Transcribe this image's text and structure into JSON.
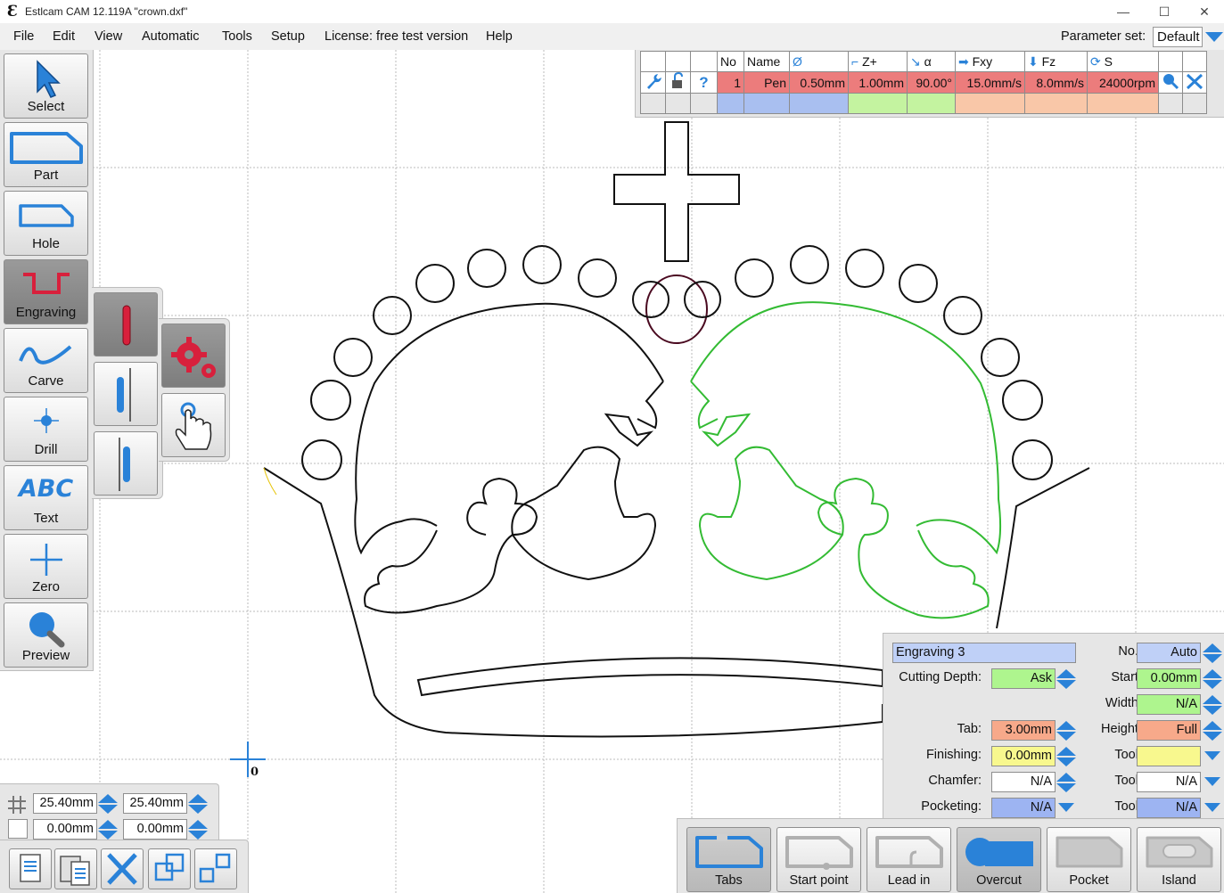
{
  "window": {
    "title": "Estlcam CAM 12.119A \"crown.dxf\"",
    "minimize": "—",
    "maximize": "☐",
    "close": "✕"
  },
  "menu": {
    "items": [
      "File",
      "Edit",
      "View",
      "Automatic",
      "Tools",
      "Setup",
      "License: free test version",
      "Help"
    ],
    "param_label": "Parameter set:",
    "param_value": "Default"
  },
  "left_toolbar": {
    "buttons": [
      {
        "label": "Select",
        "icon": "cursor-arrow-icon"
      },
      {
        "label": "Part",
        "icon": "part-outline-icon"
      },
      {
        "label": "Hole",
        "icon": "hole-outline-icon"
      },
      {
        "label": "Engraving",
        "icon": "engraving-icon",
        "active": true
      },
      {
        "label": "Carve",
        "icon": "carve-wave-icon"
      },
      {
        "label": "Drill",
        "icon": "drill-crosshair-icon"
      },
      {
        "label": "Text",
        "icon": "text-abc-icon",
        "text": "ABC"
      },
      {
        "label": "Zero",
        "icon": "zero-plus-icon"
      },
      {
        "label": "Preview",
        "icon": "magnifier-icon"
      }
    ]
  },
  "tool_table": {
    "headers": [
      "No",
      "Name",
      "Ø",
      "Z+",
      "α",
      "Fxy",
      "Fz",
      "S"
    ],
    "row": {
      "no": "1",
      "name": "Pen",
      "diameter": "0.50mm",
      "z_plus": "1.00mm",
      "angle": "90.00°",
      "fxy": "15.0mm/s",
      "fz": "8.0mm/s",
      "speed": "24000rpm"
    },
    "help_icon": "?"
  },
  "properties": {
    "name": "Engraving 3",
    "no_label": "No.:",
    "no_value": "Auto",
    "cutting_depth_label": "Cutting Depth:",
    "cutting_depth_value": "Ask",
    "start_label": "Start:",
    "start_value": "0.00mm",
    "width_label": "Width:",
    "width_value": "N/A",
    "tab_label": "Tab:",
    "tab_value": "3.00mm",
    "height_label": "Height:",
    "height_value": "Full",
    "finishing_label": "Finishing:",
    "finishing_value": "0.00mm",
    "tool1_label": "Tool:",
    "tool1_value": "",
    "chamfer_label": "Chamfer:",
    "chamfer_value": "N/A",
    "tool2_label": "Tool:",
    "tool2_value": "N/A",
    "pocketing_label": "Pocketing:",
    "pocketing_value": "N/A",
    "tool3_label": "Tool:",
    "tool3_value": "N/A"
  },
  "bottom_toolbar": {
    "buttons": [
      "Tabs",
      "Start point",
      "Lead in",
      "Overcut",
      "Pocket",
      "Island"
    ]
  },
  "grid_panel": {
    "grid_x": "25.40mm",
    "grid_y": "25.40mm",
    "offset_x": "0.00mm",
    "offset_y": "0.00mm"
  },
  "canvas": {
    "origin_label": "0",
    "colors": {
      "outline": "#000000",
      "selected": "#33bb33",
      "highlight": "#ffe600",
      "oval": "#4a0a20"
    }
  }
}
